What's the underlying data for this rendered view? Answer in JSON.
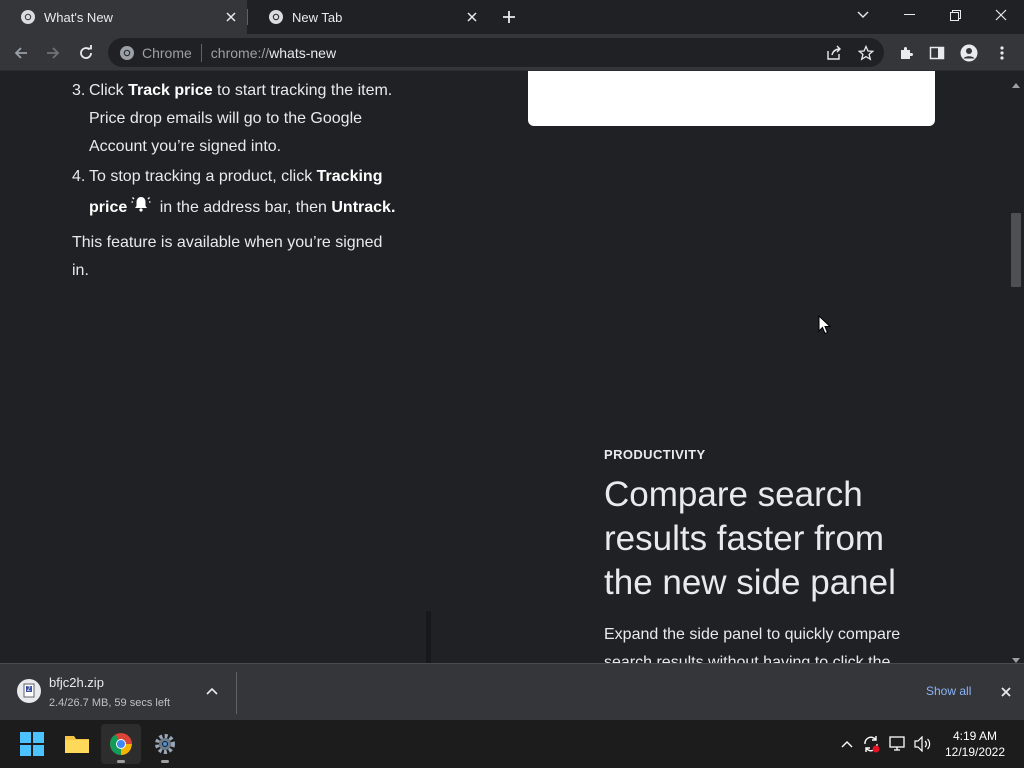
{
  "browser": {
    "tabs": [
      {
        "title": "What's New",
        "active": true
      },
      {
        "title": "New Tab",
        "active": false
      }
    ],
    "omnibox": {
      "chip_label": "Chrome",
      "url_scheme": "chrome://",
      "url_path": "whats-new"
    }
  },
  "page": {
    "steps": [
      {
        "num": "3.",
        "pre": "Click ",
        "bold1": "Track price",
        "post": " to start tracking the item. Price drop emails will go to the Google Account you’re signed into."
      },
      {
        "num": "4.",
        "pre": "To stop tracking a product, click ",
        "bold1": "Tracking price",
        "mid": " in the address bar, then ",
        "bold2": "Untrack."
      }
    ],
    "note": "This feature is available when you’re signed in.",
    "section": {
      "eyebrow": "PRODUCTIVITY",
      "headline": "Compare search results faster from the new side panel",
      "body": "Expand the side panel to quickly compare search results without having to click the"
    }
  },
  "download_shelf": {
    "filename": "bfjc2h.zip",
    "status": "2.4/26.7 MB, 59 secs left",
    "show_all": "Show all"
  },
  "taskbar": {
    "time": "4:19 AM",
    "date": "12/19/2022"
  },
  "colors": {
    "page_bg": "#202124",
    "toolbar_bg": "#35363a",
    "link_blue": "#8ab4f8",
    "text": "#e8eaed"
  }
}
